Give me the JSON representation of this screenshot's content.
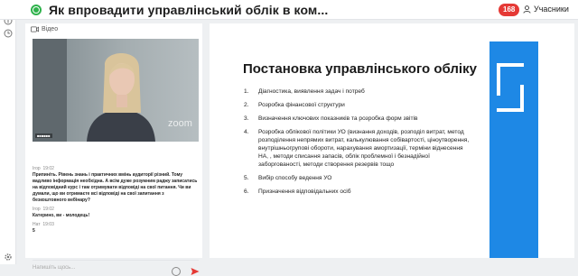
{
  "topbar": {
    "title": "Як впровадити управлінський облік в ком...",
    "count": "168",
    "participants_label": "Учасники"
  },
  "video": {
    "label": "Відео",
    "watermark": "zoom"
  },
  "chat": {
    "messages": [
      {
        "author": "Ігор",
        "time": "19:02",
        "text": "Припиніть. Рівень знань і практичних вмінь аудиторії різний. Тому вадливо інформація необхідна. А всім дуже розумним раджу записатись на відповідний курс і там отримувати відповіді на свої питання. Чи ви думали, що ви отримаєте всі відповіді на свої запитання з безкоштовного вебінару?"
      },
      {
        "author": "Ігор",
        "time": "19:02",
        "text": "Катерино, ви - молодець!"
      },
      {
        "author": "Нат",
        "time": "19:03",
        "text": "5"
      }
    ],
    "input_placeholder": "Напишіть щось..."
  },
  "slide": {
    "title": "Постановка управлінського обліку",
    "items": [
      {
        "num": "1.",
        "text": "Діагностика, виявлення задач і потреб"
      },
      {
        "num": "2.",
        "text": "Розробка фінансової структури"
      },
      {
        "num": "3.",
        "text": "Визначення ключових показників та розробка форм звітів"
      },
      {
        "num": "4.",
        "text": "Розробка облікової політики УО (визнання доходів, розподіл витрат, метод розподілення непрямих витрат, калькулювання собівартості, ціноутворення, внутрішньогрупові обороти, нарахування амортизації, терміни віднесення НА, , методи списання запасів, облік проблемної і безнадійної заборгованості, методи створення резервів тощо"
      },
      {
        "num": "5.",
        "text": "Вибір способу ведення УО"
      },
      {
        "num": "6.",
        "text": "Призначення відповідальних осіб"
      }
    ]
  },
  "colors": {
    "accent_blue": "#1e88e5",
    "rec_green": "#2fb24c",
    "badge_red": "#e53935"
  }
}
